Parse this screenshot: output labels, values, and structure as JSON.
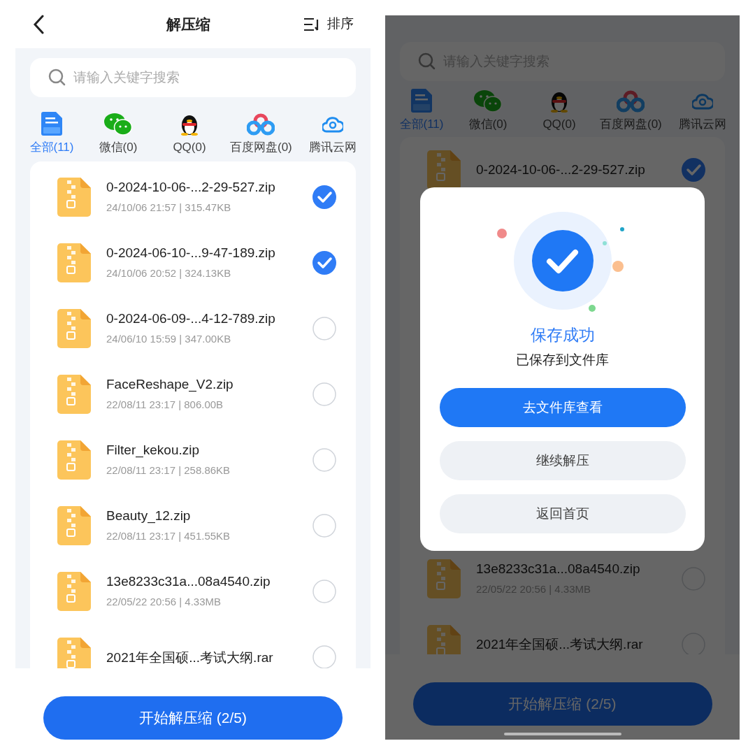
{
  "screens": [
    {
      "header": {
        "title": "解压缩",
        "sort_label": "排序"
      },
      "search": {
        "placeholder": "请输入关键字搜索"
      },
      "tabs": [
        {
          "kind": "all",
          "label": "全部(11)",
          "selected": true
        },
        {
          "kind": "wechat",
          "label": "微信(0)",
          "selected": false
        },
        {
          "kind": "qq",
          "label": "QQ(0)",
          "selected": false
        },
        {
          "kind": "baidu",
          "label": "百度网盘(0)",
          "selected": false
        },
        {
          "kind": "cloud",
          "label": "腾讯云网",
          "selected": false
        }
      ],
      "files": [
        {
          "name": "0-2024-10-06-...2-29-527.zip",
          "meta": "24/10/06 21:57 | 315.47KB",
          "checked": true
        },
        {
          "name": "0-2024-06-10-...9-47-189.zip",
          "meta": "24/10/06 20:52 | 324.13KB",
          "checked": true
        },
        {
          "name": "0-2024-06-09-...4-12-789.zip",
          "meta": "24/06/10 15:59 | 347.00KB",
          "checked": false
        },
        {
          "name": "FaceReshape_V2.zip",
          "meta": "22/08/11 23:17 | 806.00B",
          "checked": false
        },
        {
          "name": "Filter_kekou.zip",
          "meta": "22/08/11 23:17 | 258.86KB",
          "checked": false
        },
        {
          "name": "Beauty_12.zip",
          "meta": "22/08/11 23:17 | 451.55KB",
          "checked": false
        },
        {
          "name": "13e8233c31a...08a4540.zip",
          "meta": "22/05/22 20:56 | 4.33MB",
          "checked": false
        },
        {
          "name": "2021年全国硕...考试大纲.rar",
          "checked": false
        }
      ],
      "action_button": "开始解压缩 (2/5)"
    },
    {
      "search": {
        "placeholder": "请输入关键字搜索"
      },
      "tabs": [
        {
          "kind": "all",
          "label": "全部(11)",
          "selected": true
        },
        {
          "kind": "wechat",
          "label": "微信(0)",
          "selected": false
        },
        {
          "kind": "qq",
          "label": "QQ(0)",
          "selected": false
        },
        {
          "kind": "baidu",
          "label": "百度网盘(0)",
          "selected": false
        },
        {
          "kind": "cloud",
          "label": "腾讯云网",
          "selected": false
        }
      ],
      "files": [
        {
          "name": "0-2024-10-06-...2-29-527.zip",
          "checked": true
        },
        {
          "name": "13e8233c31a...08a4540.zip",
          "meta": "22/05/22 20:56 | 4.33MB",
          "checked": false
        },
        {
          "name": "2021年全国硕...考试大纲.rar",
          "checked": false
        }
      ],
      "dialog": {
        "title": "保存成功",
        "message": "已保存到文件库",
        "buttons": [
          {
            "label": "去文件库查看",
            "kind": "primary"
          },
          {
            "label": "继续解压",
            "kind": "secondary"
          },
          {
            "label": "返回首页",
            "kind": "secondary"
          }
        ]
      },
      "action_button": "开始解压缩 (2/5)"
    }
  ]
}
